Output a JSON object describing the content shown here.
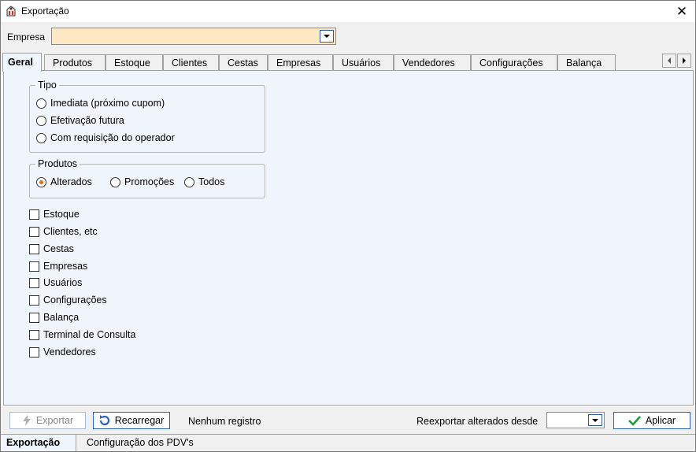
{
  "window": {
    "title": "Exportação",
    "close_glyph": "✕"
  },
  "empresa": {
    "label": "Empresa",
    "value": ""
  },
  "tabs": [
    {
      "label": "Geral",
      "active": true
    },
    {
      "label": "Produtos"
    },
    {
      "label": "Estoque"
    },
    {
      "label": "Clientes"
    },
    {
      "label": "Cestas"
    },
    {
      "label": "Empresas"
    },
    {
      "label": "Usuários"
    },
    {
      "label": "Vendedores"
    },
    {
      "label": "Configurações"
    },
    {
      "label": "Balança"
    }
  ],
  "tipo": {
    "title": "Tipo",
    "options": [
      {
        "label": "Imediata (próximo cupom)",
        "selected": false
      },
      {
        "label": "Efetivação futura",
        "selected": false
      },
      {
        "label": "Com requisição do operador",
        "selected": false
      }
    ]
  },
  "produtos": {
    "title": "Produtos",
    "options": [
      {
        "label": "Alterados",
        "selected": true
      },
      {
        "label": "Promoções",
        "selected": false
      },
      {
        "label": "Todos",
        "selected": false
      }
    ]
  },
  "checks": [
    {
      "label": "Estoque",
      "checked": false
    },
    {
      "label": "Clientes, etc",
      "checked": false
    },
    {
      "label": "Cestas",
      "checked": false
    },
    {
      "label": "Empresas",
      "checked": false
    },
    {
      "label": "Usuários",
      "checked": false
    },
    {
      "label": "Configurações",
      "checked": false
    },
    {
      "label": "Balança",
      "checked": false
    },
    {
      "label": "Terminal de Consulta",
      "checked": false
    },
    {
      "label": "Vendedores",
      "checked": false
    }
  ],
  "bottom": {
    "exportar_label": "Exportar",
    "recarregar_label": "Recarregar",
    "status": "Nenhum registro",
    "reexportar_label": "Reexportar alterados desde",
    "date_value": "",
    "aplicar_label": "Aplicar"
  },
  "bottom_tabs": [
    {
      "label": "Exportação",
      "active": true
    },
    {
      "label": "Configuração dos PDV's"
    }
  ],
  "colors": {
    "accent": "#2a60b8",
    "empresa_bg": "#fde8c4",
    "panel_bg": "#f0f4fb",
    "radio_on": "#e07010",
    "check_green": "#1f9a3a"
  }
}
